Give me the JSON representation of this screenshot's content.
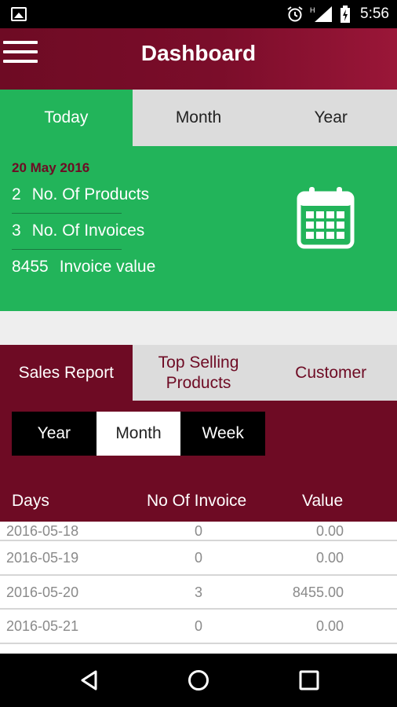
{
  "status": {
    "time": "5:56",
    "network": "H"
  },
  "appbar": {
    "title": "Dashboard"
  },
  "summary_tabs": [
    "Today",
    "Month",
    "Year"
  ],
  "summary": {
    "date": "20 May 2016",
    "products_count": "2",
    "products_label": "No. Of Products",
    "invoices_count": "3",
    "invoices_label": "No. Of Invoices",
    "invoice_value": "8455",
    "invoice_value_label": "Invoice value"
  },
  "report_tabs": {
    "sales": "Sales Report",
    "top_line1": "Top Selling",
    "top_line2": "Products",
    "customer": "Customer"
  },
  "period": [
    "Year",
    "Month",
    "Week"
  ],
  "table": {
    "headers": [
      "Days",
      "No Of Invoice",
      "Value"
    ],
    "rows": [
      {
        "day": "2016-05-18",
        "invoices": "0",
        "value": "0.00"
      },
      {
        "day": "2016-05-19",
        "invoices": "0",
        "value": "0.00"
      },
      {
        "day": "2016-05-20",
        "invoices": "3",
        "value": "8455.00"
      },
      {
        "day": "2016-05-21",
        "invoices": "0",
        "value": "0.00"
      }
    ]
  },
  "colors": {
    "maroon": "#6e0b24",
    "green": "#22b45a",
    "tab_gray": "#dcdcdc"
  }
}
